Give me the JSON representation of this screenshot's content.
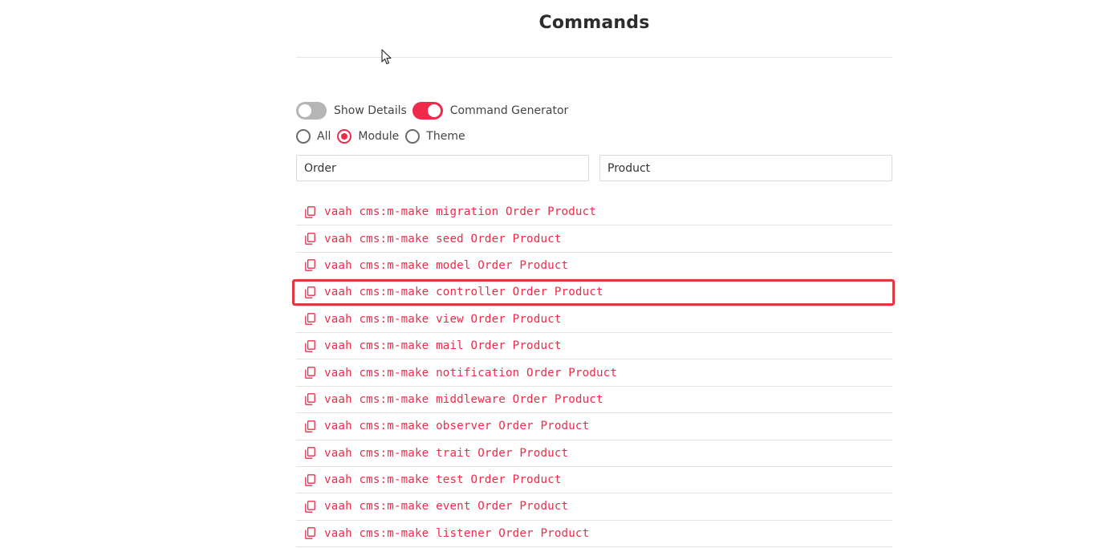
{
  "page": {
    "title": "Commands"
  },
  "toggles": {
    "show_details": {
      "label": "Show Details",
      "on": false
    },
    "command_generator": {
      "label": "Command Generator",
      "on": true
    }
  },
  "radios": {
    "options": [
      "All",
      "Module",
      "Theme"
    ],
    "selected": "Module"
  },
  "inputs": {
    "first": {
      "value": "Order"
    },
    "second": {
      "value": "Product"
    }
  },
  "commands": [
    "vaah cms:m-make migration Order Product",
    "vaah cms:m-make seed Order Product",
    "vaah cms:m-make model Order Product",
    "vaah cms:m-make controller Order Product",
    "vaah cms:m-make view Order Product",
    "vaah cms:m-make mail Order Product",
    "vaah cms:m-make notification Order Product",
    "vaah cms:m-make middleware Order Product",
    "vaah cms:m-make observer Order Product",
    "vaah cms:m-make trait Order Product",
    "vaah cms:m-make test Order Product",
    "vaah cms:m-make event Order Product",
    "vaah cms:m-make listener Order Product"
  ],
  "highlighted_command": "vaah cms:m-make controller Order Product",
  "icons": {
    "command_row": "copy-icon"
  },
  "colors": {
    "accent": "#ee2b4a",
    "highlight_border": "#dd3a3e",
    "toggle_off": "#b5b5b5"
  }
}
